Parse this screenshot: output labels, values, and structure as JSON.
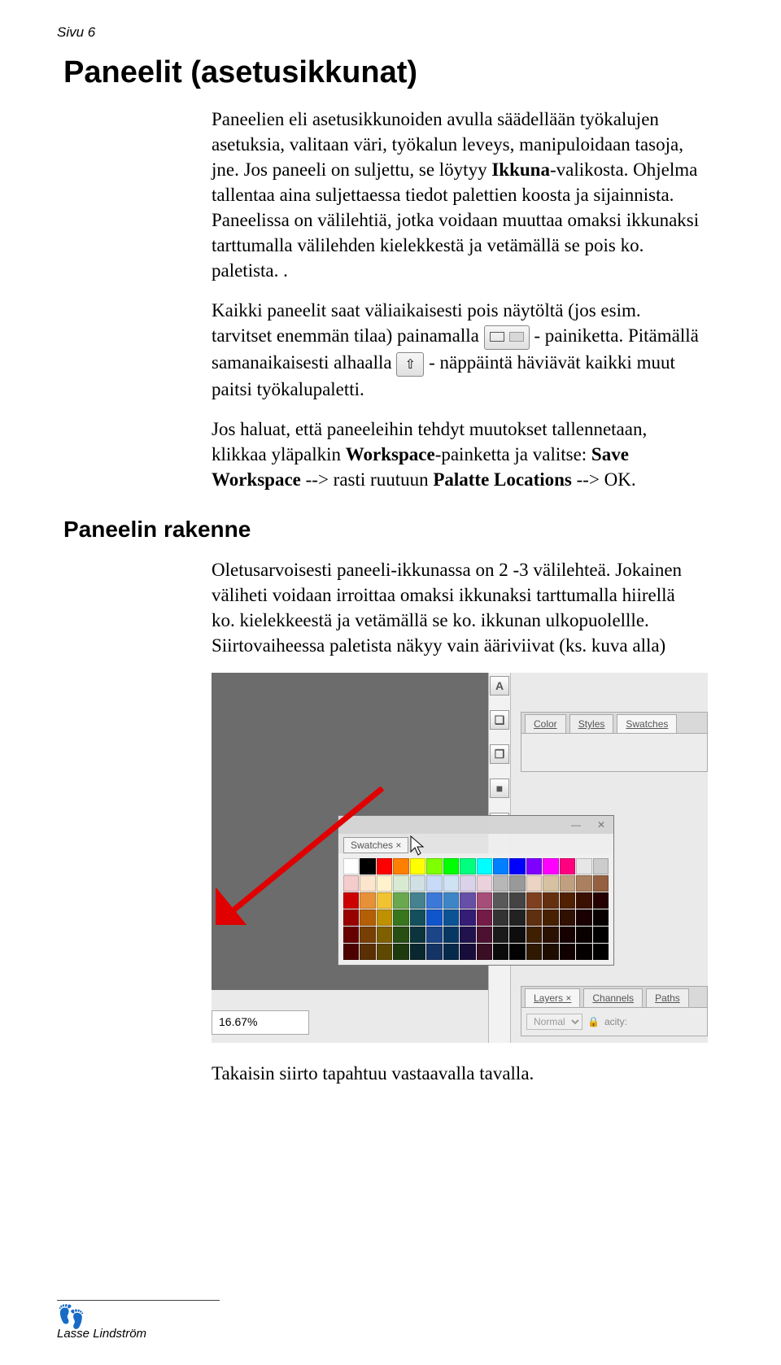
{
  "page": {
    "number_label": "Sivu 6",
    "footer_author": "Lasse Lindström"
  },
  "section1": {
    "heading": "Paneelit (asetusikkunat)",
    "p1_a": "Paneelien eli asetusikkunoiden avulla säädellään työkalujen asetuksia, valitaan väri, työkalun leveys, manipuloidaan tasoja, jne. Jos paneeli on suljettu, se löytyy ",
    "p1_bold": "Ikkuna",
    "p1_b": "-valikosta. Ohjelma tallentaa aina suljettaessa tiedot palettien koosta ja sijainnista. Paneelissa on välilehtiä, jotka voidaan muuttaa omaksi ikkunaksi tarttumalla välilehden kielekkestä ja vetämällä se pois ko. paletista. .",
    "p2_a": "Kaikki paneelit saat väliaikaisesti pois näytöltä (jos esim. tarvitset enemmän tilaa) painamalla ",
    "p2_b": " - painiketta. Pitämällä samanaikaisesti alhaalla ",
    "p2_c": " - näppäintä häviävät kaikki muut paitsi työkalupaletti.",
    "p3_a": "Jos haluat, että paneeleihin tehdyt muutokset tallennetaan, klikkaa yläpalkin ",
    "p3_b1": "Workspace",
    "p3_c": "-painketta ja valitse: ",
    "p3_b2": "Save Workspace",
    "p3_d": " --> rasti ruutuun ",
    "p3_b3": "Palatte Locations",
    "p3_e": " --> OK."
  },
  "section2": {
    "heading": "Paneelin rakenne",
    "p1": "Oletusarvoisesti paneeli-ikkunassa on 2 -3 välilehteä. Jokainen väliheti voidaan irroittaa omaksi ikkunaksi tarttumalla hiirellä ko. kielekkeestä ja vetämällä se ko. ikkunan ulkopuolellle. Siirtovaiheessa paletista näkyy vain ääriviivat (ks. kuva alla)",
    "p2": "Takaisin siirto tapahtuu vastaavalla tavalla."
  },
  "screenshot": {
    "zoom": "16.67%",
    "sidebar_icons": [
      "A",
      "❏",
      "❒",
      "■",
      "≡"
    ],
    "panel_colors_tabs": [
      "Color",
      "Styles",
      "Swatches"
    ],
    "panel_layers": {
      "tabs": [
        "Layers ×",
        "Channels",
        "Paths"
      ],
      "mode": "Normal",
      "opacity_label": "acity:"
    },
    "floating_tab": "Swatches ×",
    "swatch_colors": [
      "#ffffff",
      "#000000",
      "#ff0000",
      "#ff7f00",
      "#ffff00",
      "#7fff00",
      "#00ff00",
      "#00ff7f",
      "#00ffff",
      "#007fff",
      "#0000ff",
      "#7f00ff",
      "#ff00ff",
      "#ff007f",
      "#e6e6e6",
      "#cccccc",
      "#f4cccc",
      "#fce5cd",
      "#fff2cc",
      "#d9ead3",
      "#d0e0e3",
      "#c9daf8",
      "#cfe2f3",
      "#d9d2e9",
      "#ead1dc",
      "#b7b7b7",
      "#999999",
      "#ebd4c3",
      "#d6c2a1",
      "#c0a080",
      "#aa8060",
      "#946040",
      "#cc0000",
      "#e69138",
      "#f1c232",
      "#6aa84f",
      "#45818e",
      "#3c78d8",
      "#3d85c6",
      "#674ea7",
      "#a64d79",
      "#595959",
      "#444444",
      "#7e4020",
      "#653010",
      "#502000",
      "#3a1000",
      "#240000",
      "#990000",
      "#b45f06",
      "#bf9000",
      "#38761d",
      "#134f5c",
      "#1155cc",
      "#0b5394",
      "#351c75",
      "#741b47",
      "#333333",
      "#222222",
      "#5e3010",
      "#472000",
      "#301000",
      "#1a0000",
      "#080000",
      "#660000",
      "#783f04",
      "#7f6000",
      "#274e13",
      "#0c343d",
      "#1c4587",
      "#073763",
      "#20124d",
      "#4c1130",
      "#1a1a1a",
      "#0d0d0d",
      "#3e2000",
      "#2a1000",
      "#170000",
      "#0a0000",
      "#000000",
      "#4d0000",
      "#5a2f03",
      "#5f4800",
      "#1d3a0e",
      "#09272e",
      "#153365",
      "#05294a",
      "#180d3a",
      "#390d24",
      "#0a0a0a",
      "#020202",
      "#2e1800",
      "#1f0c00",
      "#110000",
      "#050000",
      "#000000"
    ]
  }
}
